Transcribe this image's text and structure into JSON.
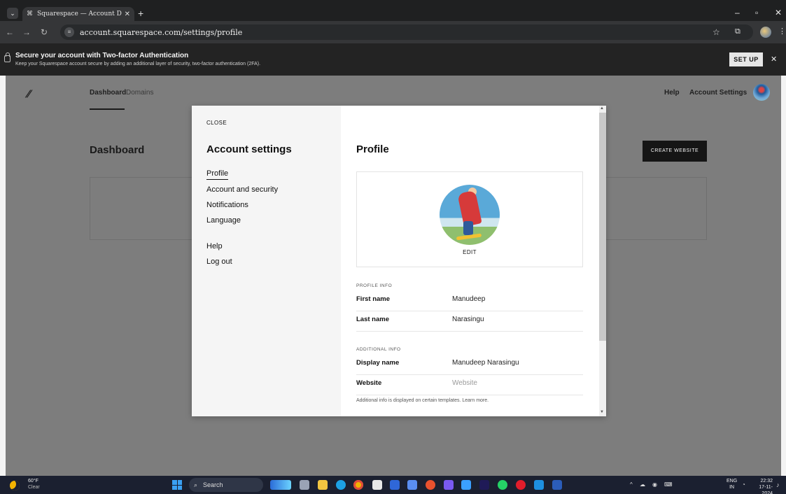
{
  "browser": {
    "tab_title": "Squarespace — Account Dashb",
    "url": "account.squarespace.com/settings/profile"
  },
  "banner": {
    "title": "Secure your account with Two-factor Authentication",
    "subtitle": "Keep your Squarespace account secure by adding an additional layer of security, two-factor authentication (2FA).",
    "setup_label": "SET UP"
  },
  "app": {
    "nav": [
      "Dashboard",
      "Domains"
    ],
    "right_links": [
      "Help",
      "Account Settings"
    ],
    "page_title": "Dashboard",
    "create_button": "CREATE WEBSITE"
  },
  "modal": {
    "close_label": "CLOSE",
    "heading": "Account settings",
    "menu": [
      "Profile",
      "Account and security",
      "Notifications",
      "Language"
    ],
    "menu2": [
      "Help",
      "Log out"
    ],
    "panel_title": "Profile",
    "edit_label": "EDIT",
    "profile_info_label": "PROFILE INFO",
    "profile_rows": [
      {
        "label": "First name",
        "value": "Manudeep"
      },
      {
        "label": "Last name",
        "value": "Narasingu"
      }
    ],
    "additional_info_label": "ADDITIONAL INFO",
    "additional_rows": [
      {
        "label": "Display name",
        "value": "Manudeep Narasingu"
      },
      {
        "label": "Website",
        "placeholder": "Website"
      }
    ],
    "note": "Additional info is displayed on certain templates. Learn more."
  },
  "taskbar": {
    "temperature": "60°F",
    "condition": "Clear",
    "search_placeholder": "Search",
    "lang_top": "ENG",
    "lang_bottom": "IN",
    "time": "22:32",
    "date": "17-11-2024"
  },
  "colors": {
    "banner_bg": "#232323",
    "overlay": "#7d7d7d",
    "taskbar_bg": "#1b2030",
    "windows_blue": "#3aa0f3"
  }
}
